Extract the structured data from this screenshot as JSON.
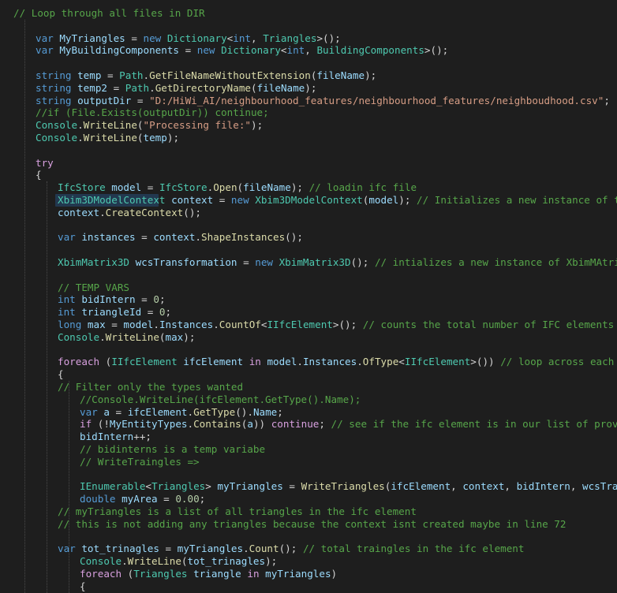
{
  "editor": {
    "colors": {
      "background": "#1e1e1e",
      "keyword": "#569cd6",
      "control": "#d8a0df",
      "type": "#4ec9b0",
      "variable": "#9cdcfe",
      "method": "#dcdcaa",
      "string": "#d69d85",
      "comment": "#57a64a",
      "number": "#b5cea8",
      "punctuation": "#d4d4d4",
      "selection": "#264f78"
    },
    "lines": [
      [
        [
          "cmt",
          "// Loop through all files in DIR"
        ]
      ],
      [],
      [
        [
          "kw",
          "var "
        ],
        [
          "var",
          "MyTriangles"
        ],
        [
          "pun",
          " = "
        ],
        [
          "kw",
          "new "
        ],
        [
          "typ",
          "Dictionary"
        ],
        [
          "pun",
          "<"
        ],
        [
          "kw",
          "int"
        ],
        [
          "pun",
          ", "
        ],
        [
          "typ",
          "Triangles"
        ],
        [
          "pun",
          ">();"
        ]
      ],
      [
        [
          "kw",
          "var "
        ],
        [
          "var",
          "MyBuildingComponents"
        ],
        [
          "pun",
          " = "
        ],
        [
          "kw",
          "new "
        ],
        [
          "typ",
          "Dictionary"
        ],
        [
          "pun",
          "<"
        ],
        [
          "kw",
          "int"
        ],
        [
          "pun",
          ", "
        ],
        [
          "typ",
          "BuildingComponents"
        ],
        [
          "pun",
          ">();"
        ]
      ],
      [],
      [
        [
          "kw",
          "string "
        ],
        [
          "var",
          "temp"
        ],
        [
          "pun",
          " = "
        ],
        [
          "typ",
          "Path"
        ],
        [
          "pun",
          "."
        ],
        [
          "fn",
          "GetFileNameWithoutExtension"
        ],
        [
          "pun",
          "("
        ],
        [
          "var",
          "fileName"
        ],
        [
          "pun",
          ");"
        ]
      ],
      [
        [
          "kw",
          "string "
        ],
        [
          "var",
          "temp2"
        ],
        [
          "pun",
          " = "
        ],
        [
          "typ",
          "Path"
        ],
        [
          "pun",
          "."
        ],
        [
          "fn",
          "GetDirectoryName"
        ],
        [
          "pun",
          "("
        ],
        [
          "var",
          "fileName"
        ],
        [
          "pun",
          ");"
        ]
      ],
      [
        [
          "kw",
          "string "
        ],
        [
          "var",
          "outputDir"
        ],
        [
          "pun",
          " = "
        ],
        [
          "str",
          "\"D:/HiWi_AI/neighbourhood_features/neighbourhood_features/neighboudhood.csv\""
        ],
        [
          "pun",
          ";"
        ]
      ],
      [
        [
          "cmt",
          "//if (File.Exists(outputDir)) continue;"
        ]
      ],
      [
        [
          "typ",
          "Console"
        ],
        [
          "pun",
          "."
        ],
        [
          "fn",
          "WriteLine"
        ],
        [
          "pun",
          "("
        ],
        [
          "str",
          "\"Processing file:\""
        ],
        [
          "pun",
          ");"
        ]
      ],
      [
        [
          "typ",
          "Console"
        ],
        [
          "pun",
          "."
        ],
        [
          "fn",
          "WriteLine"
        ],
        [
          "pun",
          "("
        ],
        [
          "var",
          "temp"
        ],
        [
          "pun",
          ");"
        ]
      ],
      [],
      [
        [
          "ctl",
          "try"
        ]
      ],
      [
        [
          "pun",
          "{"
        ]
      ],
      [
        [
          "typ",
          "IfcStore"
        ],
        [
          "pun",
          " "
        ],
        [
          "var",
          "model"
        ],
        [
          "pun",
          " = "
        ],
        [
          "typ",
          "IfcStore"
        ],
        [
          "pun",
          "."
        ],
        [
          "fn",
          "Open"
        ],
        [
          "pun",
          "("
        ],
        [
          "var",
          "fileName"
        ],
        [
          "pun",
          "); "
        ],
        [
          "cmt",
          "// loadin ifc file"
        ]
      ],
      [
        [
          "typ",
          "Xbim3DModelContext"
        ],
        [
          "pun",
          " "
        ],
        [
          "var",
          "context"
        ],
        [
          "pun",
          " = "
        ],
        [
          "kw",
          "new "
        ],
        [
          "typ",
          "Xbim3DModelContext"
        ],
        [
          "pun",
          "("
        ],
        [
          "var",
          "model"
        ],
        [
          "pun",
          "); "
        ],
        [
          "cmt",
          "// Initializes a new instance of the Xbim"
        ]
      ],
      [
        [
          "var",
          "context"
        ],
        [
          "pun",
          "."
        ],
        [
          "fn",
          "CreateContext"
        ],
        [
          "pun",
          "();"
        ]
      ],
      [],
      [
        [
          "kw",
          "var "
        ],
        [
          "var",
          "instances"
        ],
        [
          "pun",
          " = "
        ],
        [
          "var",
          "context"
        ],
        [
          "pun",
          "."
        ],
        [
          "fn",
          "ShapeInstances"
        ],
        [
          "pun",
          "();"
        ]
      ],
      [],
      [
        [
          "typ",
          "XbimMatrix3D"
        ],
        [
          "pun",
          " "
        ],
        [
          "var",
          "wcsTransformation"
        ],
        [
          "pun",
          " = "
        ],
        [
          "kw",
          "new "
        ],
        [
          "typ",
          "XbimMatrix3D"
        ],
        [
          "pun",
          "(); "
        ],
        [
          "cmt",
          "// intializes a new instance of XbimMAtrix3D ("
        ]
      ],
      [],
      [
        [
          "cmt",
          "// TEMP VARS"
        ]
      ],
      [
        [
          "kw",
          "int "
        ],
        [
          "var",
          "bidIntern"
        ],
        [
          "pun",
          " = "
        ],
        [
          "num",
          "0"
        ],
        [
          "pun",
          ";"
        ]
      ],
      [
        [
          "kw",
          "int "
        ],
        [
          "var",
          "triangleId"
        ],
        [
          "pun",
          " = "
        ],
        [
          "num",
          "0"
        ],
        [
          "pun",
          ";"
        ]
      ],
      [
        [
          "kw",
          "long "
        ],
        [
          "var",
          "max"
        ],
        [
          "pun",
          " = "
        ],
        [
          "var",
          "model"
        ],
        [
          "pun",
          "."
        ],
        [
          "var",
          "Instances"
        ],
        [
          "pun",
          "."
        ],
        [
          "fn",
          "CountOf"
        ],
        [
          "pun",
          "<"
        ],
        [
          "typ",
          "IIfcElement"
        ],
        [
          "pun",
          ">(); "
        ],
        [
          "cmt",
          "// counts the total number of IFC elements"
        ]
      ],
      [
        [
          "typ",
          "Console"
        ],
        [
          "pun",
          "."
        ],
        [
          "fn",
          "WriteLine"
        ],
        [
          "pun",
          "("
        ],
        [
          "var",
          "max"
        ],
        [
          "pun",
          ");"
        ]
      ],
      [],
      [
        [
          "ctl",
          "foreach "
        ],
        [
          "pun",
          "("
        ],
        [
          "typ",
          "IIfcElement"
        ],
        [
          "pun",
          " "
        ],
        [
          "var",
          "ifcElement"
        ],
        [
          "pun",
          " "
        ],
        [
          "ctl",
          "in "
        ],
        [
          "var",
          "model"
        ],
        [
          "pun",
          "."
        ],
        [
          "var",
          "Instances"
        ],
        [
          "pun",
          "."
        ],
        [
          "fn",
          "OfType"
        ],
        [
          "pun",
          "<"
        ],
        [
          "typ",
          "IIfcElement"
        ],
        [
          "pun",
          ">()) "
        ],
        [
          "cmt",
          "// loop across each ifc el"
        ]
      ],
      [
        [
          "pun",
          "{"
        ]
      ],
      [
        [
          "cmt",
          "// Filter only the types wanted"
        ]
      ],
      [
        [
          "cmt",
          "//Console.WriteLine(ifcElement.GetType().Name);"
        ]
      ],
      [
        [
          "kw",
          "var "
        ],
        [
          "var",
          "a"
        ],
        [
          "pun",
          " = "
        ],
        [
          "var",
          "ifcElement"
        ],
        [
          "pun",
          "."
        ],
        [
          "fn",
          "GetType"
        ],
        [
          "pun",
          "()."
        ],
        [
          "var",
          "Name"
        ],
        [
          "pun",
          ";"
        ]
      ],
      [
        [
          "ctl",
          "if "
        ],
        [
          "pun",
          "(!"
        ],
        [
          "var",
          "MyEntityTypes"
        ],
        [
          "pun",
          "."
        ],
        [
          "fn",
          "Contains"
        ],
        [
          "pun",
          "("
        ],
        [
          "var",
          "a"
        ],
        [
          "pun",
          ")) "
        ],
        [
          "ctl",
          "continue"
        ],
        [
          "pun",
          "; "
        ],
        [
          "cmt",
          "// see if the ifc element is in our list of provided e"
        ]
      ],
      [
        [
          "var",
          "bidIntern"
        ],
        [
          "pun",
          "++;"
        ]
      ],
      [
        [
          "cmt",
          "// bidinterns is a temp variabe"
        ]
      ],
      [
        [
          "cmt",
          "// WriteTraingles =>"
        ]
      ],
      [],
      [
        [
          "typ",
          "IEnumerable"
        ],
        [
          "pun",
          "<"
        ],
        [
          "typ",
          "Triangles"
        ],
        [
          "pun",
          "> "
        ],
        [
          "var",
          "myTriangles"
        ],
        [
          "pun",
          " = "
        ],
        [
          "fn",
          "WriteTriangles"
        ],
        [
          "pun",
          "("
        ],
        [
          "var",
          "ifcElement"
        ],
        [
          "pun",
          ", "
        ],
        [
          "var",
          "context"
        ],
        [
          "pun",
          ", "
        ],
        [
          "var",
          "bidIntern"
        ],
        [
          "pun",
          ", "
        ],
        [
          "var",
          "wcsTransforma"
        ]
      ],
      [
        [
          "kw",
          "double "
        ],
        [
          "var",
          "myArea"
        ],
        [
          "pun",
          " = "
        ],
        [
          "num",
          "0.00"
        ],
        [
          "pun",
          ";"
        ]
      ],
      [
        [
          "cmt",
          "// myTriangles is a list of all triangles in the ifc element"
        ]
      ],
      [
        [
          "cmt",
          "// this is not adding any triangles because the context isnt created maybe in line 72"
        ]
      ],
      [],
      [
        [
          "kw",
          "var "
        ],
        [
          "var",
          "tot_trinagles"
        ],
        [
          "pun",
          " = "
        ],
        [
          "var",
          "myTriangles"
        ],
        [
          "pun",
          "."
        ],
        [
          "fn",
          "Count"
        ],
        [
          "pun",
          "(); "
        ],
        [
          "cmt",
          "// total traingles in the ifc element"
        ]
      ],
      [
        [
          "typ",
          "Console"
        ],
        [
          "pun",
          "."
        ],
        [
          "fn",
          "WriteLine"
        ],
        [
          "pun",
          "("
        ],
        [
          "var",
          "tot_trinagles"
        ],
        [
          "pun",
          ");"
        ]
      ],
      [
        [
          "ctl",
          "foreach "
        ],
        [
          "pun",
          "("
        ],
        [
          "typ",
          "Triangles"
        ],
        [
          "pun",
          " "
        ],
        [
          "var",
          "triangle"
        ],
        [
          "pun",
          " "
        ],
        [
          "ctl",
          "in "
        ],
        [
          "var",
          "myTriangles"
        ],
        [
          "pun",
          ")"
        ]
      ],
      [
        [
          "pun",
          "{"
        ]
      ]
    ]
  }
}
